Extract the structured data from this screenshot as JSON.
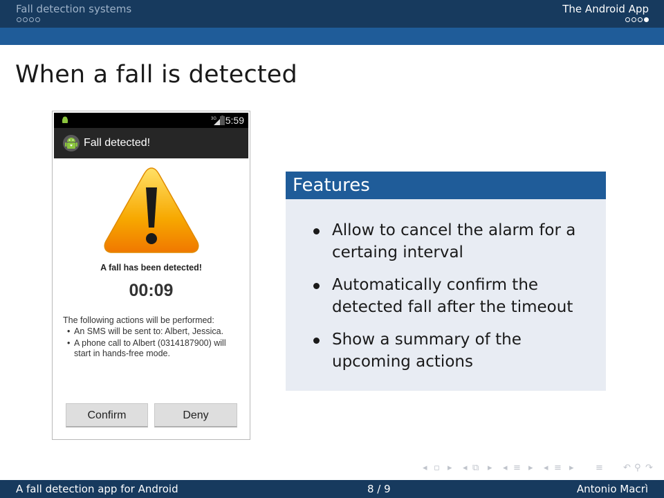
{
  "header": {
    "section_left": "Fall detection systems",
    "section_right": "The Android App",
    "left_dots": 4,
    "right_dots": 4,
    "right_current_dot": 4
  },
  "frame": {
    "title": "When a fall is detected"
  },
  "phone": {
    "status_time": "5:59",
    "app_title": "Fall detected!",
    "message": "A fall has been detected!",
    "timer": "00:09",
    "actions_heading": "The following actions will be performed:",
    "actions": [
      "An SMS will be sent to: Albert, Jessica.",
      "A phone call to Albert (0314187900) will start in hands-free mode."
    ],
    "confirm_label": "Confirm",
    "deny_label": "Deny"
  },
  "features": {
    "title": "Features",
    "items": [
      "Allow to cancel the alarm for a certaing interval",
      "Automatically confirm the detected fall after the timeout",
      "Show a summary of the upcoming actions"
    ]
  },
  "footer": {
    "left": "A fall detection app for Android",
    "center": "8 / 9",
    "right": "Antonio Macrì"
  },
  "colors": {
    "header_dark": "#173a5e",
    "header_band": "#1f5c99",
    "block_body": "#e8ecf3",
    "warning_orange": "#f7a800"
  }
}
